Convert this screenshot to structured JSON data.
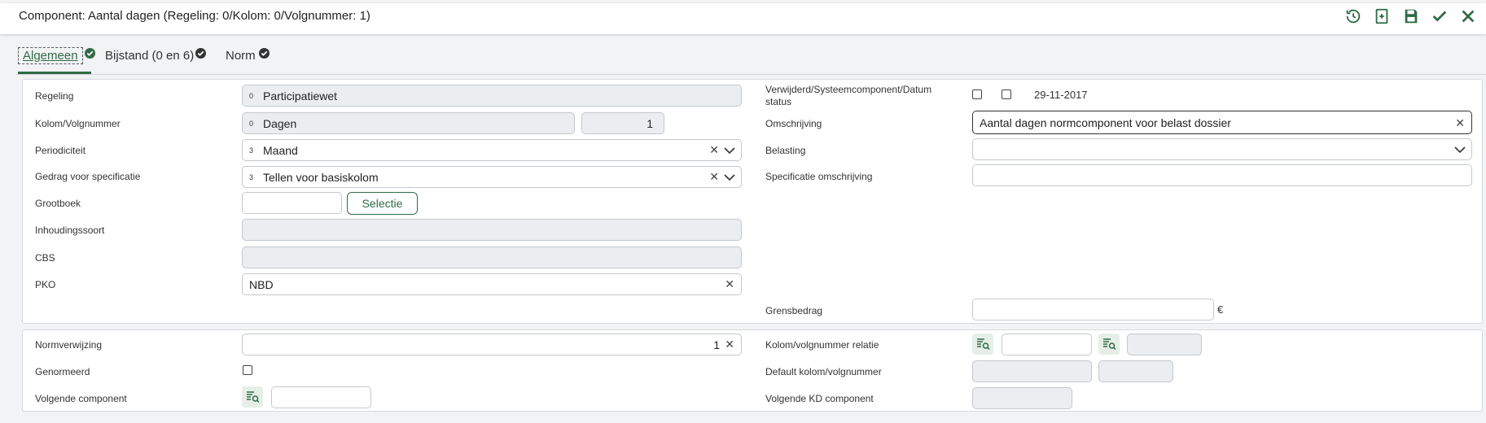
{
  "header": {
    "title": "Component: Aantal dagen (Regeling: 0/Kolom: 0/Volgnummer: 1)",
    "icons": [
      "history-icon",
      "export-icon",
      "save-icon",
      "check-icon",
      "close-icon"
    ]
  },
  "tabs": [
    {
      "label": "Algemeen"
    },
    {
      "label": "Bijstand (0 en 6)"
    },
    {
      "label": "Norm"
    }
  ],
  "left": {
    "regeling": {
      "label": "Regeling",
      "code": "0",
      "value": "Participatiewet"
    },
    "kolom": {
      "label": "Kolom/Volgnummer",
      "code": "0",
      "value": "Dagen",
      "volgnummer": "1"
    },
    "periodiciteit": {
      "label": "Periodiciteit",
      "code": "3",
      "value": "Maand"
    },
    "gedrag": {
      "label": "Gedrag voor specificatie",
      "code": "3",
      "value": "Tellen voor basiskolom"
    },
    "grootboek": {
      "label": "Grootboek",
      "value": "",
      "button": "Selectie"
    },
    "inhoudingssoort": {
      "label": "Inhoudingssoort",
      "value": ""
    },
    "cbs": {
      "label": "CBS",
      "value": ""
    },
    "pko": {
      "label": "PKO",
      "value": "NBD"
    }
  },
  "right": {
    "verwijderd": {
      "label": "Verwijderd/Systeemcomponent/Datum status",
      "datum": "29-11-2017"
    },
    "omschrijving": {
      "label": "Omschrijving",
      "value": "Aantal dagen normcomponent voor belast dossier"
    },
    "belasting": {
      "label": "Belasting",
      "value": ""
    },
    "specificatie": {
      "label": "Specificatie omschrijving",
      "value": ""
    },
    "grensbedrag": {
      "label": "Grensbedrag",
      "value": "",
      "currency": "€"
    }
  },
  "bottom": {
    "normverwijzing": {
      "label": "Normverwijzing",
      "value": "1"
    },
    "genormeerd": {
      "label": "Genormeerd"
    },
    "volgende": {
      "label": "Volgende component",
      "value": ""
    },
    "kolomrelatie": {
      "label": "Kolom/volgnummer relatie"
    },
    "defaultkolom": {
      "label": "Default kolom/volgnummer"
    },
    "volgendekd": {
      "label": "Volgende KD component"
    }
  },
  "colors": {
    "accent": "#2e6b45",
    "readonly": "#ebedf0"
  }
}
